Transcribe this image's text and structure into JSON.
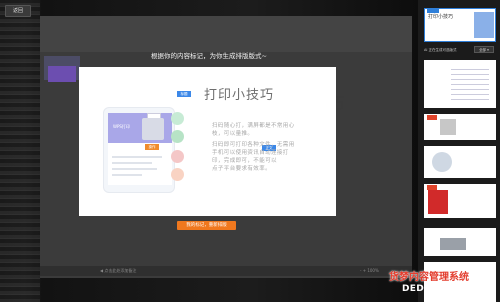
{
  "topbar": {
    "back_label": "返回"
  },
  "overlay": {
    "headline": "根据你的内容标记，为你生成排版版式~",
    "action_button": "我的标记，重新排版"
  },
  "modal": {
    "title": "打印小技巧",
    "lines": [
      "扫码随心打，满屏都是不常用心",
      "枝，可以量推。",
      "扫码即可打印各种文件，无需用",
      "手机可以使用资讯自动连接打",
      "印，完成即可，不能可以",
      "点子平台要求有效率。"
    ],
    "tags": {
      "orange": "操作",
      "blue_top": "标题",
      "blue_side": "正文"
    },
    "brand": "WPS打印"
  },
  "background_slide": {
    "char": "巧"
  },
  "app": {
    "footer_hint": "◀ 点击此处添加备注",
    "footer_meta": "- + 100%"
  },
  "side_panel": {
    "label": "AI 正在生成可选版式",
    "select": "全部 ▾",
    "thumb1_title": "打印小技巧"
  },
  "watermark": {
    "title": "货梦内容管理系统",
    "site": "DEDECMS.COM"
  },
  "colors": {
    "accent_orange": "#f0781e",
    "accent_blue": "#3c88e8",
    "selection_blue": "#2f7fd9",
    "watermark_red": "#e33d2e"
  }
}
